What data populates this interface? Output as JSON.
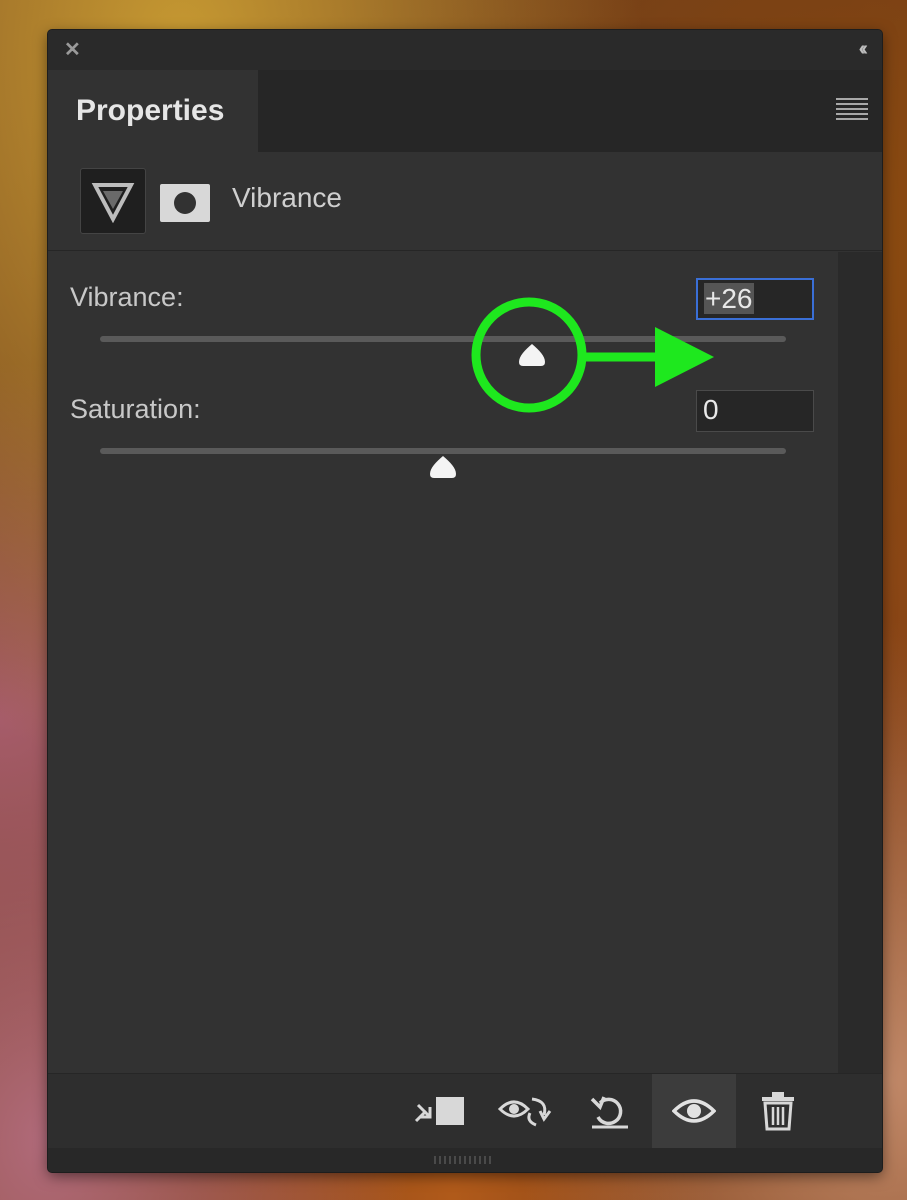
{
  "panel": {
    "tab_label": "Properties",
    "adjustment_title": "Vibrance"
  },
  "controls": {
    "vibrance": {
      "label": "Vibrance:",
      "value": "+26",
      "min": -100,
      "max": 100,
      "numeric_value": 26
    },
    "saturation": {
      "label": "Saturation:",
      "value": "0",
      "min": -100,
      "max": 100,
      "numeric_value": 0
    }
  },
  "footer": {
    "buttons": [
      {
        "name": "clip-to-layer-icon"
      },
      {
        "name": "view-previous-state-icon"
      },
      {
        "name": "reset-adjustment-icon"
      },
      {
        "name": "toggle-visibility-icon",
        "active": true
      },
      {
        "name": "trash-icon"
      }
    ]
  },
  "annotation": {
    "color": "#1ee81e"
  }
}
